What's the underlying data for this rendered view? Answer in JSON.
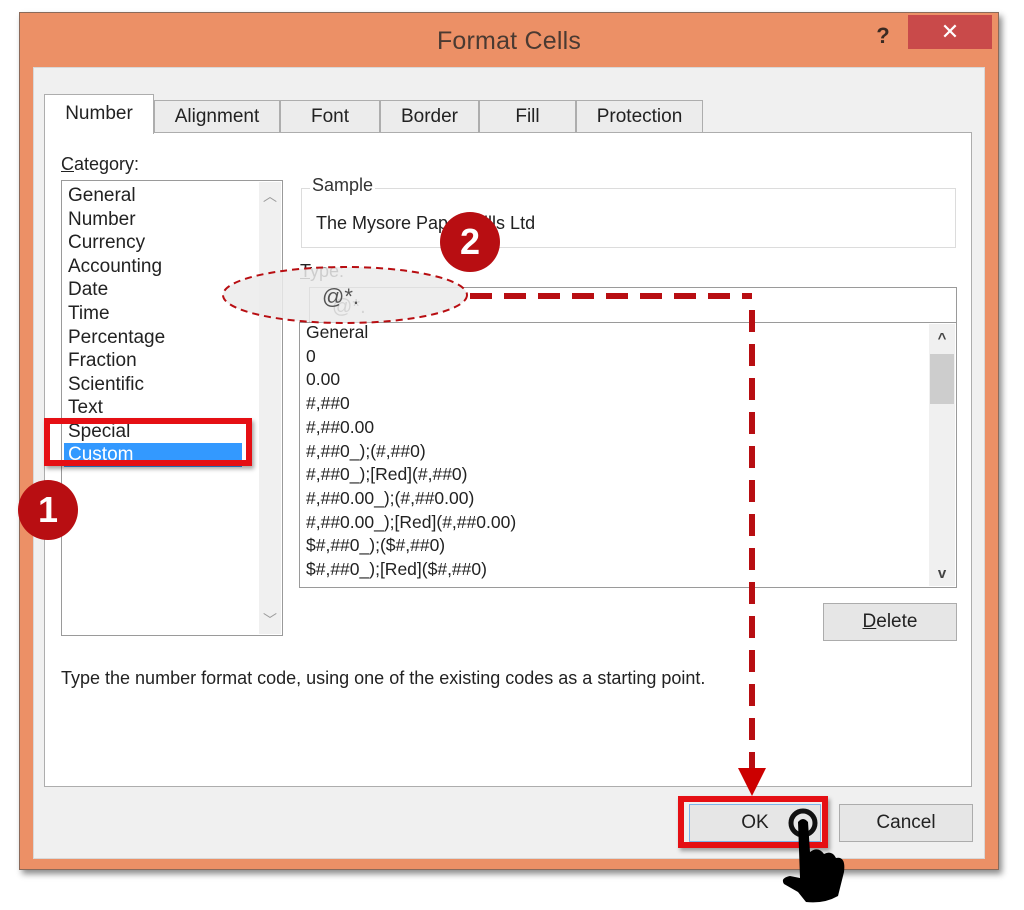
{
  "window": {
    "title": "Format Cells",
    "help_label": "?",
    "close_label": "✕",
    "frame_color": "#ec9066",
    "close_color": "#c94a4a"
  },
  "tabs": [
    {
      "label": "Number",
      "active": true
    },
    {
      "label": "Alignment",
      "active": false
    },
    {
      "label": "Font",
      "active": false
    },
    {
      "label": "Border",
      "active": false
    },
    {
      "label": "Fill",
      "active": false
    },
    {
      "label": "Protection",
      "active": false
    }
  ],
  "category": {
    "label_first": "C",
    "label_rest": "ategory:",
    "items": [
      "General",
      "Number",
      "Currency",
      "Accounting",
      "Date",
      "Time",
      "Percentage",
      "Fraction",
      "Scientific",
      "Text",
      "Special"
    ],
    "selected": "Custom",
    "selection_color": "#3399ff"
  },
  "sample": {
    "legend": "Sample",
    "value": "The Mysore Paper Mills Ltd"
  },
  "type": {
    "label_first": "T",
    "label_rest": "ype:",
    "value": "@*.",
    "list_items": [
      "General",
      "0",
      "0.00",
      "#,##0",
      "#,##0.00",
      "#,##0_);(#,##0)",
      "#,##0_);[Red](#,##0)",
      "#,##0.00_);(#,##0.00)",
      "#,##0.00_);[Red](#,##0.00)",
      "$#,##0_);($#,##0)",
      "$#,##0_);[Red]($#,##0)"
    ]
  },
  "buttons": {
    "delete_first": "D",
    "delete_rest": "elete",
    "ok": "OK",
    "cancel": "Cancel"
  },
  "description": "Type the number format code, using one of the existing codes as a starting point.",
  "annotations": {
    "step1": "1",
    "step2": "2",
    "color": "#b80e12",
    "highlight_color": "#e50f14"
  }
}
